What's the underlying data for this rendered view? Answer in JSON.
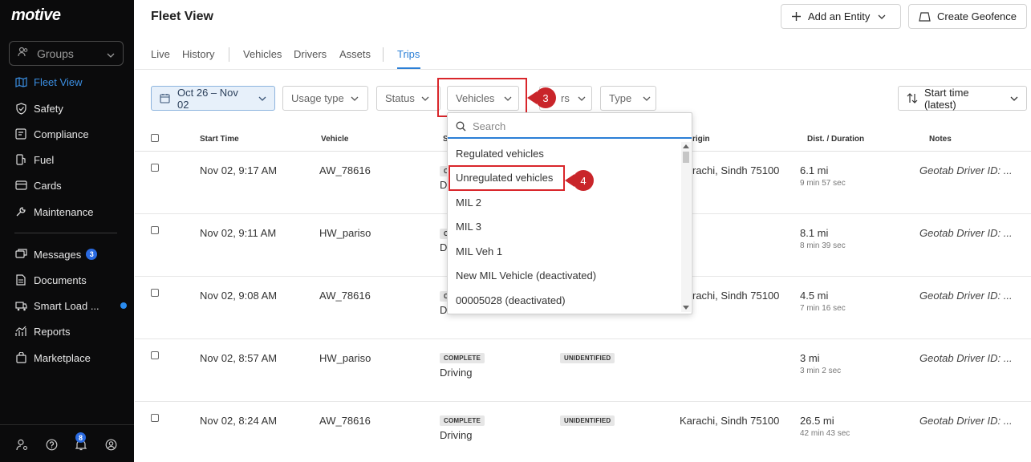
{
  "brand": "motive",
  "sidebar": {
    "groups_label": "Groups",
    "items": [
      {
        "label": "Fleet View",
        "icon": "map-icon"
      },
      {
        "label": "Safety",
        "icon": "shield-icon"
      },
      {
        "label": "Compliance",
        "icon": "compliance-icon"
      },
      {
        "label": "Fuel",
        "icon": "fuel-icon"
      },
      {
        "label": "Cards",
        "icon": "card-icon"
      },
      {
        "label": "Maintenance",
        "icon": "wrench-icon"
      },
      {
        "label": "Messages",
        "icon": "messages-icon",
        "badge": "3"
      },
      {
        "label": "Documents",
        "icon": "document-icon"
      },
      {
        "label": "Smart Load ...",
        "icon": "truck-icon"
      },
      {
        "label": "Reports",
        "icon": "reports-icon"
      },
      {
        "label": "Marketplace",
        "icon": "bag-icon"
      }
    ],
    "bell_badge": "8"
  },
  "header": {
    "title": "Fleet View",
    "add_entity_label": "Add an Entity",
    "create_geofence_label": "Create Geofence"
  },
  "tabs": [
    "Live",
    "History",
    "Vehicles",
    "Drivers",
    "Assets",
    "Trips"
  ],
  "active_tab": "Trips",
  "filters": {
    "date": "Oct 26 – Nov 02",
    "usage_type": "Usage type",
    "status": "Status",
    "vehicles": "Vehicles",
    "drivers_partial": "rs",
    "type": "Type",
    "sort": "Start time (latest)"
  },
  "callouts": {
    "three": "3",
    "four": "4"
  },
  "table": {
    "headers": {
      "start_time": "Start Time",
      "vehicle": "Vehicle",
      "status_partial": "S",
      "origin_partial": "rigin",
      "distance": "Dist. / Duration",
      "notes": "Notes"
    },
    "rows": [
      {
        "start": "Nov 02, 9:17 AM",
        "vehicle": "AW_78616",
        "chip": "C",
        "status": "D",
        "tag": "",
        "origin": "rachi, Sindh 75100",
        "dist": "6.1 mi",
        "dur": "9 min 57 sec",
        "note": "Geotab Driver ID: ..."
      },
      {
        "start": "Nov 02, 9:11 AM",
        "vehicle": "HW_pariso",
        "chip": "C",
        "status": "D",
        "tag": "",
        "origin": "",
        "dist": "8.1 mi",
        "dur": "8 min 39 sec",
        "note": "Geotab Driver ID: ..."
      },
      {
        "start": "Nov 02, 9:08 AM",
        "vehicle": "AW_78616",
        "chip": "C",
        "status": "D",
        "tag": "",
        "origin": "rachi, Sindh 75100",
        "dist": "4.5 mi",
        "dur": "7 min 16 sec",
        "note": "Geotab Driver ID: ..."
      },
      {
        "start": "Nov 02, 8:57 AM",
        "vehicle": "HW_pariso",
        "chip": "COMPLETE",
        "status": "Driving",
        "tag": "UNIDENTIFIED",
        "origin": "",
        "dist": "3 mi",
        "dur": "3 min 2 sec",
        "note": "Geotab Driver ID: ..."
      },
      {
        "start": "Nov 02, 8:24 AM",
        "vehicle": "AW_78616",
        "chip": "COMPLETE",
        "status": "Driving",
        "tag": "UNIDENTIFIED",
        "origin": "Karachi, Sindh 75100",
        "dist": "26.5 mi",
        "dur": "42 min 43 sec",
        "note": "Geotab Driver ID: ..."
      }
    ]
  },
  "dropdown": {
    "search_placeholder": "Search",
    "options": [
      "Regulated vehicles",
      "Unregulated vehicles",
      "MIL 2",
      "MIL 3",
      "MIL Veh 1",
      "New MIL Vehicle (deactivated)",
      "00005028 (deactivated)"
    ]
  },
  "colors": {
    "accent": "#2b7fd6",
    "callout": "#c9252a",
    "sidebar_bg": "#0b0b0c"
  }
}
